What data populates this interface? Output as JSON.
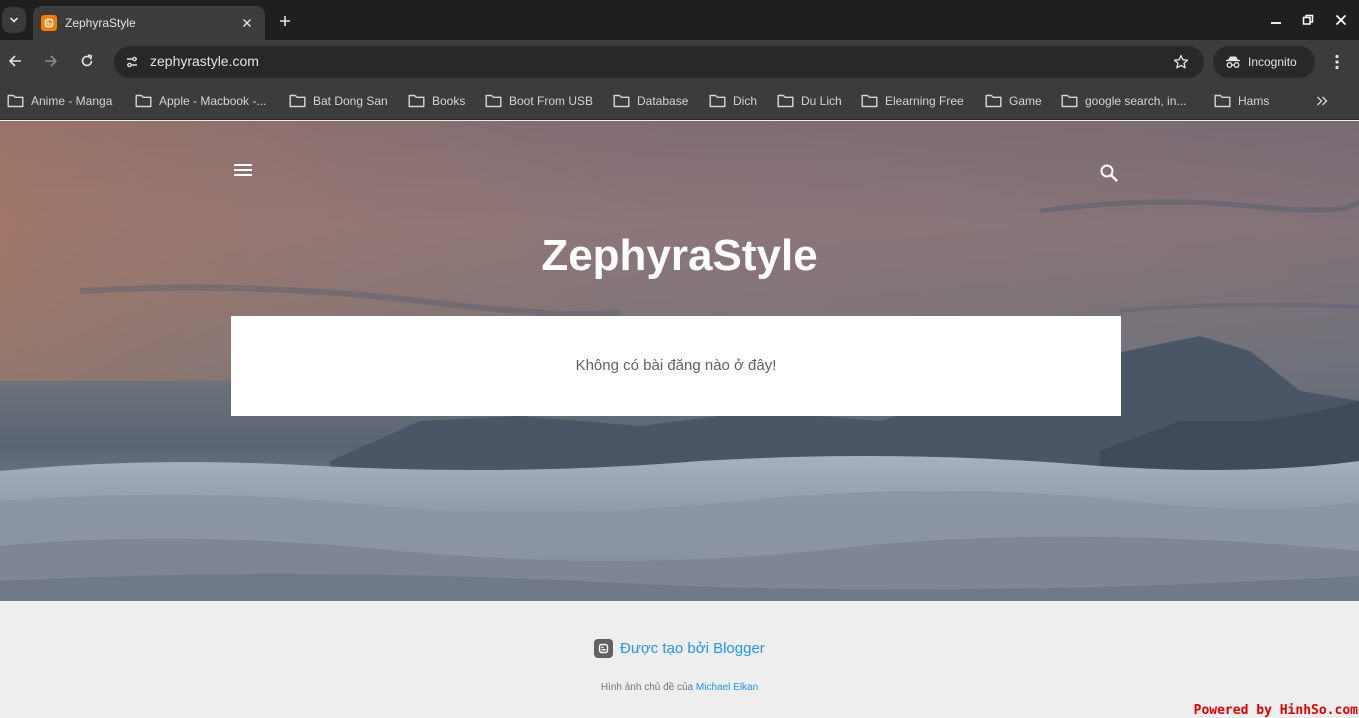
{
  "browser": {
    "tab": {
      "title": "ZephyraStyle"
    },
    "url": "zephyrastyle.com",
    "incognito_label": "Incognito",
    "bookmarks": [
      "Anime - Manga",
      "Apple - Macbook -...",
      "Bat Dong San",
      "Books",
      "Boot From USB",
      "Database",
      "Dich",
      "Du Lich",
      "Elearning Free",
      "Game",
      "google search, in...",
      "Hams"
    ]
  },
  "page": {
    "site_title": "ZephyraStyle",
    "empty_message": "Không có bài đăng nào ở đây!"
  },
  "footer": {
    "powered_by": "Được tạo bởi Blogger",
    "attribution_prefix": "Hình ảnh chủ đề của",
    "attribution_author": "Michael Elkan"
  },
  "watermark": "Powered by HinhSo.com",
  "colors": {
    "link": "#2196f3",
    "favicon": "#f57c00",
    "watermark": "#e00000"
  }
}
